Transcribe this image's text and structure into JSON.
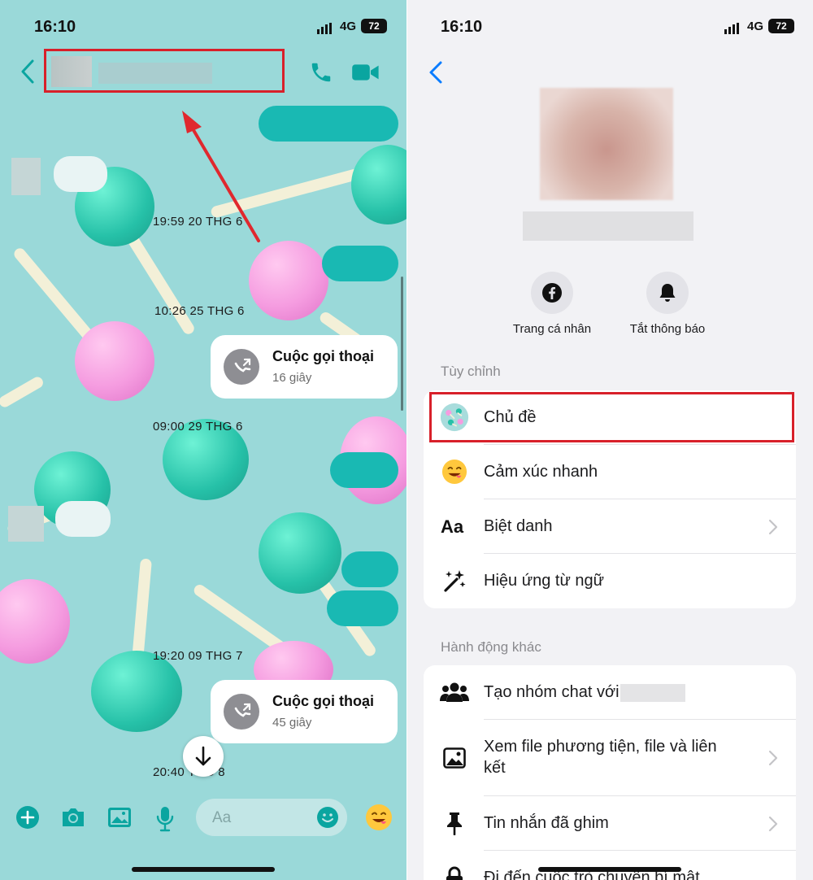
{
  "status": {
    "time": "16:10",
    "network": "4G",
    "battery": "72"
  },
  "chat": {
    "timestamps": [
      "19:59 20 THG 6",
      "10:26 25 THG 6",
      "09:00 29 THG 6",
      "19:20 09 THG 7",
      "20:40 THG 8"
    ],
    "calls": [
      {
        "title": "Cuộc gọi thoại",
        "duration": "16 giây"
      },
      {
        "title": "Cuộc gọi thoại",
        "duration": "45 giây"
      }
    ],
    "composer": {
      "placeholder": "Aa"
    }
  },
  "info": {
    "actions": [
      {
        "label": "Trang cá nhân",
        "icon": "facebook-icon"
      },
      {
        "label": "Tắt thông báo",
        "icon": "bell-icon"
      }
    ],
    "sections": [
      {
        "title": "Tùy chỉnh",
        "items": [
          {
            "label": "Chủ đề",
            "icon": "theme-icon"
          },
          {
            "label": "Cảm xúc nhanh",
            "icon": "emoji-icon"
          },
          {
            "label": "Biệt danh",
            "icon": "text-aa-icon"
          },
          {
            "label": "Hiệu ứng từ ngữ",
            "icon": "magic-wand-icon"
          }
        ]
      },
      {
        "title": "Hành động khác",
        "items": [
          {
            "label": "Tạo nhóm chat với",
            "icon": "people-icon"
          },
          {
            "label": "Xem file phương tiện, file và liên kết",
            "icon": "image-icon"
          },
          {
            "label": "Tin nhắn đã ghim",
            "icon": "pin-icon"
          },
          {
            "label": "Đi đến cuộc trò chuyện bí mật",
            "icon": "lock-icon"
          }
        ]
      }
    ]
  },
  "colors": {
    "accent": "#0a7cff",
    "chat_bg": "#9ad9d9",
    "highlight": "#d8202a",
    "bubble": "#19b9b3",
    "icon_teal": "#0aa5a0"
  }
}
